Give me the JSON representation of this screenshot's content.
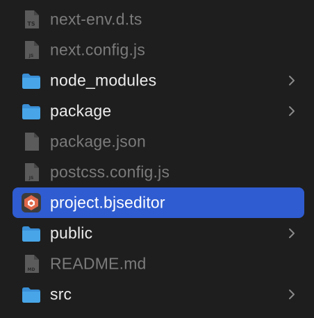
{
  "colors": {
    "background": "#1e1e1e",
    "selection": "#2f5cd0",
    "folder": "#48a6e8",
    "doc_dim": "#5b5b5b",
    "text_dim": "#7b7b7b",
    "text_bright": "#ececec",
    "chevron": "#8a8a8a"
  },
  "files": [
    {
      "name": "next-env.d.ts",
      "kind": "file",
      "icon": "ts-file-icon",
      "badge": "TS",
      "dim": true
    },
    {
      "name": "next.config.js",
      "kind": "file",
      "icon": "js-file-icon",
      "badge": "JS",
      "dim": true
    },
    {
      "name": "node_modules",
      "kind": "folder",
      "icon": "folder-icon",
      "badge": "",
      "dim": false
    },
    {
      "name": "package",
      "kind": "folder",
      "icon": "folder-icon",
      "badge": "",
      "dim": false
    },
    {
      "name": "package.json",
      "kind": "file",
      "icon": "document-icon",
      "badge": "",
      "dim": true
    },
    {
      "name": "postcss.config.js",
      "kind": "file",
      "icon": "js-file-icon",
      "badge": "JS",
      "dim": true
    },
    {
      "name": "project.bjseditor",
      "kind": "app",
      "icon": "babylon-editor-icon",
      "badge": "",
      "dim": false,
      "selected": true
    },
    {
      "name": "public",
      "kind": "folder",
      "icon": "folder-icon",
      "badge": "",
      "dim": false
    },
    {
      "name": "README.md",
      "kind": "file",
      "icon": "md-file-icon",
      "badge": "MD",
      "dim": true
    },
    {
      "name": "src",
      "kind": "folder",
      "icon": "folder-icon",
      "badge": "",
      "dim": false
    }
  ]
}
